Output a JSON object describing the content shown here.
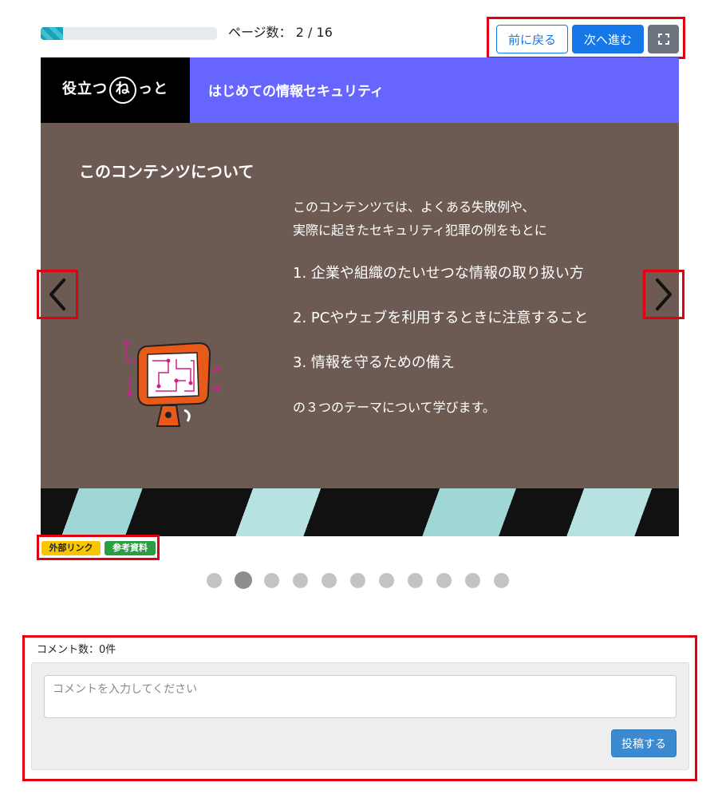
{
  "progress": {
    "fraction": 0.125,
    "label": "ページ数： 2 / 16"
  },
  "controls": {
    "prev_label": "前に戻る",
    "next_label": "次へ進む",
    "fullscreen_icon": "fullscreen-icon"
  },
  "slide": {
    "logo_text_left": "役立つ",
    "logo_text_circle": "ね",
    "logo_text_right": "っと",
    "header_title": "はじめての情報セキュリティ",
    "title": "このコンテンツについて",
    "intro_line1": "このコンテンツでは、よくある失敗例や、",
    "intro_line2": "実際に起きたセキュリティ犯罪の例をもとに",
    "items": [
      "1.  企業や組織のたいせつな情報の取り扱い方",
      "2.  PCやウェブを利用するときに注意すること",
      "3.  情報を守るための備え"
    ],
    "outro": "の３つのテーマについて学びます。",
    "colors": {
      "background": "#6d5b53",
      "header": "#6666ff",
      "logo_bg": "#000000"
    }
  },
  "nav": {
    "left_icon": "chevron-left-icon",
    "right_icon": "chevron-right-icon"
  },
  "tags": {
    "external_link": "外部リンク",
    "reference": "参考資料"
  },
  "pagination": {
    "dot_count": 11,
    "active_index": 1
  },
  "comments": {
    "count_label": "コメント数：0件",
    "placeholder": "コメントを入力してください",
    "post_label": "投稿する"
  }
}
